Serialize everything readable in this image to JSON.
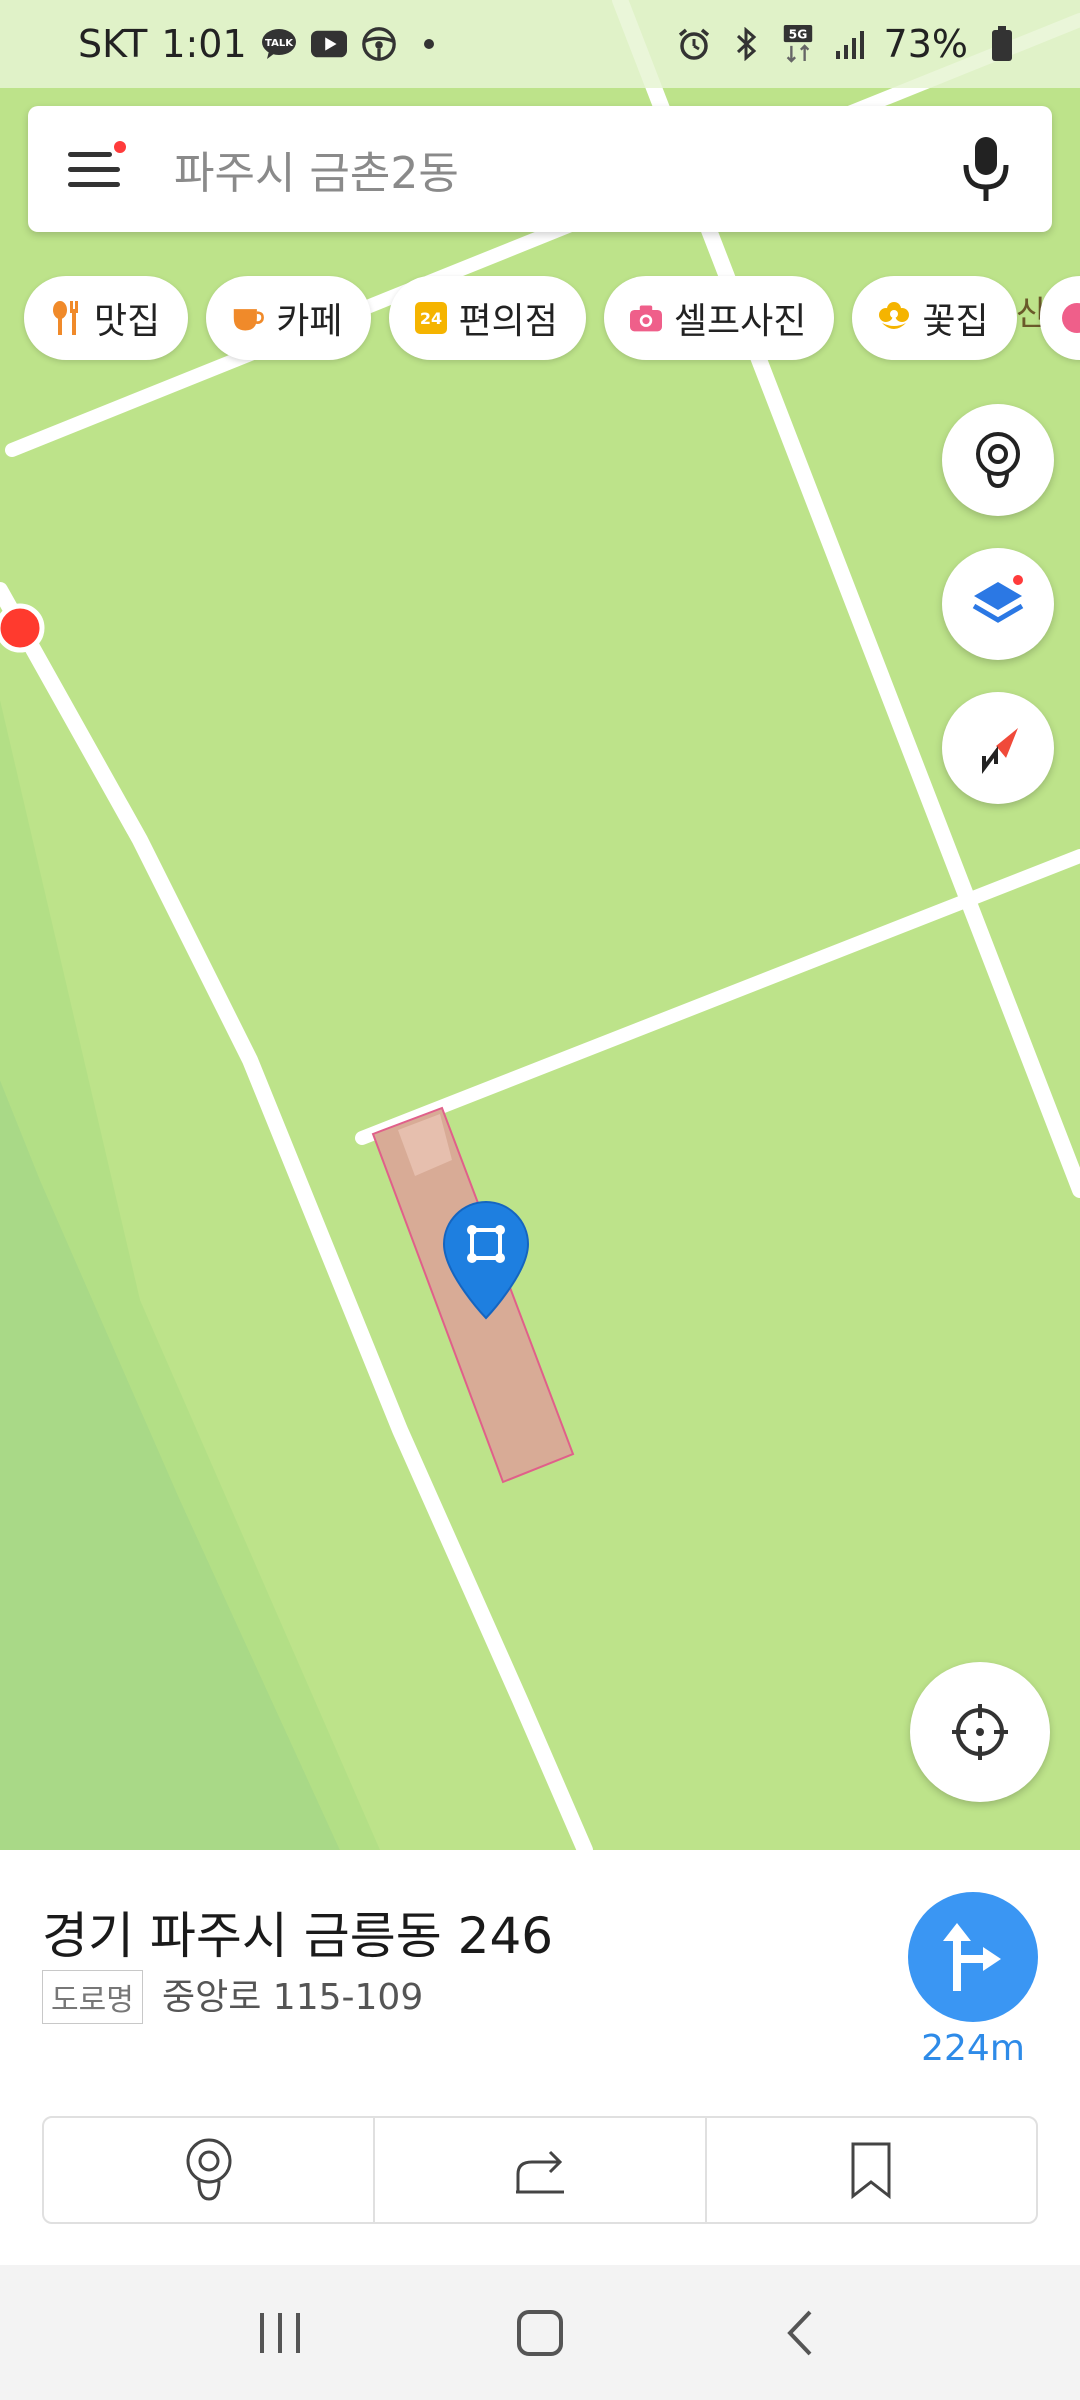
{
  "status_bar": {
    "carrier": "SKT",
    "time": "1:01",
    "talk_label": "TALK",
    "network": "5G",
    "battery": "73%"
  },
  "search": {
    "placeholder": "파주시 금촌2동"
  },
  "chips": [
    {
      "label": "맛집",
      "icon": "restaurant-icon",
      "color": "#f08a2a"
    },
    {
      "label": "카페",
      "icon": "cafe-icon",
      "color": "#f08a2a"
    },
    {
      "label": "편의점",
      "icon": "convenience-store-icon",
      "icon_text": "24",
      "color": "#f5b400"
    },
    {
      "label": "셀프사진",
      "icon": "camera-icon",
      "color": "#ef5f8a"
    },
    {
      "label": "꽃집",
      "icon": "flower-icon",
      "color": "#f5b400"
    }
  ],
  "map": {
    "partial_label": "산",
    "colors": {
      "land": "#bde38a",
      "road": "#ffffff",
      "parcel_fill": "#d8ab96",
      "parcel_border": "#e0608a",
      "pin": "#1e7fe0"
    }
  },
  "place": {
    "address": "경기 파주시 금릉동 246",
    "road_tag": "도로명",
    "road_address": "중앙로 115-109",
    "distance": "224m"
  },
  "accent_color": "#3a96f3"
}
